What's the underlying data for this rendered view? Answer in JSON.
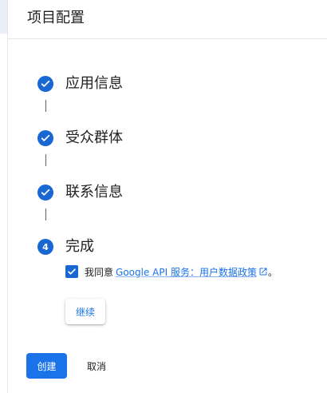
{
  "header": {
    "title": "项目配置"
  },
  "steps": [
    {
      "label": "应用信息",
      "status": "complete",
      "icon": "check-icon"
    },
    {
      "label": "受众群体",
      "status": "complete",
      "icon": "check-icon"
    },
    {
      "label": "联系信息",
      "status": "complete",
      "icon": "check-icon"
    },
    {
      "label": "完成",
      "status": "current",
      "number": "4"
    }
  ],
  "agreement": {
    "checked": true,
    "prefix": "我同意",
    "link_text": "Google API 服务：用户数据政策",
    "suffix": "。"
  },
  "buttons": {
    "continue": "继续",
    "create": "创建",
    "cancel": "取消"
  },
  "colors": {
    "accent": "#1a73e8",
    "step_circle": "#1967d2"
  }
}
